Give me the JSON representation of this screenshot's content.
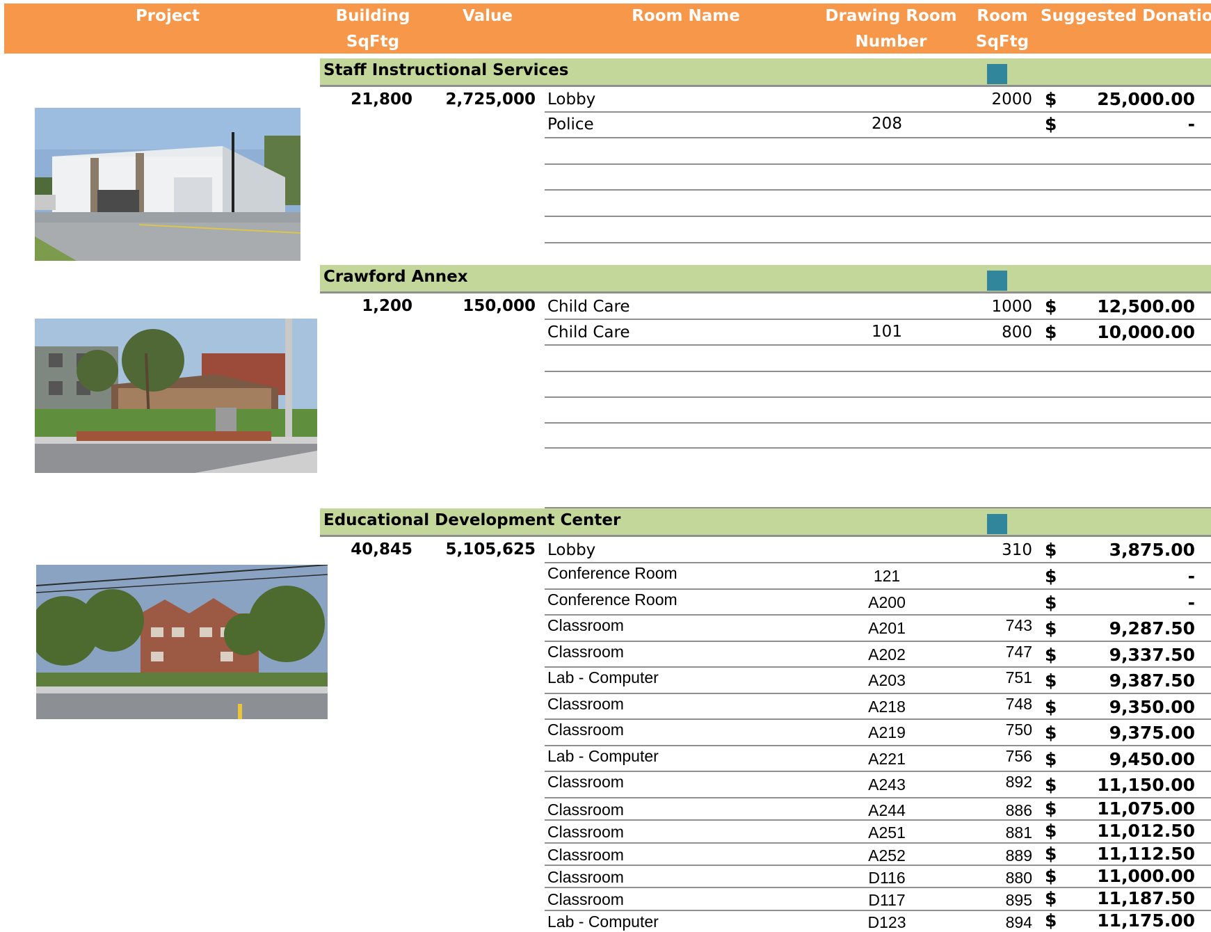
{
  "header": {
    "project": "Project",
    "building_sqftg_line1": "Building",
    "building_sqftg_line2": "SqFtg",
    "value": "Value",
    "room_name": "Room Name",
    "drawing_room_number_line1": "Drawing Room",
    "drawing_room_number_line2": "Number",
    "room_sqftg_line1": "Room",
    "room_sqftg_line2": "SqFtg",
    "suggested_donation": "Suggested Donation"
  },
  "colors": {
    "header_bg": "#f7974a",
    "section_bg": "#c4d79b",
    "section_marker": "#31869b"
  },
  "sections": [
    {
      "title": "Staff Instructional Services",
      "building_sqftg": "21,800",
      "value": "2,725,000",
      "photo": "warehouse-building-photo",
      "rows": [
        {
          "room": "Lobby",
          "drawing": "",
          "sqftg": "2000",
          "currency": "$",
          "donation": "25,000.00"
        },
        {
          "room": "Police",
          "drawing": "208",
          "sqftg": "",
          "currency": "$",
          "donation": "-"
        }
      ]
    },
    {
      "title": "Crawford Annex",
      "building_sqftg": "1,200",
      "value": "150,000",
      "photo": "annex-building-photo",
      "rows": [
        {
          "room": "Child Care",
          "drawing": "",
          "sqftg": "1000",
          "currency": "$",
          "donation": "12,500.00"
        },
        {
          "room": "Child Care",
          "drawing": "101",
          "sqftg": "800",
          "currency": "$",
          "donation": "10,000.00"
        }
      ]
    },
    {
      "title": "Educational Development Center",
      "building_sqftg": "40,845",
      "value": "5,105,625",
      "photo": "brick-school-photo",
      "rows": [
        {
          "room": "Lobby",
          "drawing": "",
          "sqftg": "310",
          "currency": "$",
          "donation": "3,875.00"
        },
        {
          "room": "Conference Room",
          "drawing": "121",
          "sqftg": "",
          "currency": "$",
          "donation": "-"
        },
        {
          "room": "Conference Room",
          "drawing": "A200",
          "sqftg": "",
          "currency": "$",
          "donation": "-"
        },
        {
          "room": "Classroom",
          "drawing": "A201",
          "sqftg": "743",
          "currency": "$",
          "donation": "9,287.50"
        },
        {
          "room": "Classroom",
          "drawing": "A202",
          "sqftg": "747",
          "currency": "$",
          "donation": "9,337.50"
        },
        {
          "room": "Lab - Computer",
          "drawing": "A203",
          "sqftg": "751",
          "currency": "$",
          "donation": "9,387.50"
        },
        {
          "room": "Classroom",
          "drawing": "A218",
          "sqftg": "748",
          "currency": "$",
          "donation": "9,350.00"
        },
        {
          "room": "Classroom",
          "drawing": "A219",
          "sqftg": "750",
          "currency": "$",
          "donation": "9,375.00"
        },
        {
          "room": "Lab - Computer",
          "drawing": "A221",
          "sqftg": "756",
          "currency": "$",
          "donation": "9,450.00"
        },
        {
          "room": "Classroom",
          "drawing": "A243",
          "sqftg": "892",
          "currency": "$",
          "donation": "11,150.00"
        },
        {
          "room": "Classroom",
          "drawing": "A244",
          "sqftg": "886",
          "currency": "$",
          "donation": "11,075.00"
        },
        {
          "room": "Classroom",
          "drawing": "A251",
          "sqftg": "881",
          "currency": "$",
          "donation": "11,012.50"
        },
        {
          "room": "Classroom",
          "drawing": "A252",
          "sqftg": "889",
          "currency": "$",
          "donation": "11,112.50"
        },
        {
          "room": "Classroom",
          "drawing": "D116",
          "sqftg": "880",
          "currency": "$",
          "donation": "11,000.00"
        },
        {
          "room": "Classroom",
          "drawing": "D117",
          "sqftg": "895",
          "currency": "$",
          "donation": "11,187.50"
        },
        {
          "room": "Lab - Computer",
          "drawing": "D123",
          "sqftg": "894",
          "currency": "$",
          "donation": "11,175.00"
        }
      ]
    }
  ]
}
